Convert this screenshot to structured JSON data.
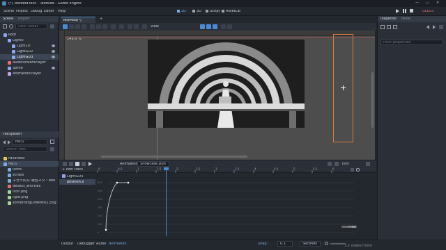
{
  "window": {
    "title": "(*) TestMod.tscn - TestMod - Godot Engine",
    "controls": [
      "—",
      "□",
      "✕"
    ]
  },
  "menu": [
    "Scene",
    "Project",
    "Debug",
    "Editor",
    "Help"
  ],
  "workspaces": [
    "2D",
    "3D",
    "Script",
    "AssetLib"
  ],
  "renderer": "GLES3",
  "scene_dock": {
    "tabs": [
      "Scene",
      "Import"
    ],
    "filter_placeholder": "Filter nodes",
    "nodes": [
      "Root",
      "Light0",
      "Light2D",
      "LightGD2",
      "LightGD3",
      "AudioStreamPlayer",
      "Sprite",
      "AnimationPlayer"
    ]
  },
  "filesystem_dock": {
    "title": "FileSystem",
    "path": "res://",
    "search_placeholder": "Search files",
    "favorites": "Favorites:",
    "files": [
      "res://",
      "icons",
      "scripts",
      "ネガテ的な 場合ネタ・WAT",
      "default_env.tres",
      "icon.png",
      "light.png",
      "somethingDifferent2.png"
    ]
  },
  "scene_tabs": [
    "TestMod(*)",
    "+"
  ],
  "viewport": {
    "zoom": "149.8 %",
    "toolbar_label": "View"
  },
  "animation": {
    "panel_label": "Animation",
    "animation_name": "Showcase.json",
    "add_track": "+ Add Track",
    "edit": "Edit",
    "tracks": [
      "LightGD3",
      "position:x"
    ],
    "ruler": [
      "0",
      "0.5",
      "1",
      "1.5",
      "2",
      "2.5",
      "3",
      "3.5",
      "4",
      "4.5",
      "5",
      "5.5",
      "6"
    ],
    "yvals": [
      "0",
      "100",
      "200",
      "300",
      "400",
      "500",
      "600"
    ],
    "snap_label": "Snap:",
    "snap_value": "0.1",
    "units": "Seconds",
    "free": "Free"
  },
  "inspector": {
    "tabs": [
      "Inspector",
      "Node"
    ],
    "filter_placeholder": "Filter properties"
  },
  "bottom_tabs": [
    "Output",
    "Debugger",
    "Audio",
    "Animation"
  ],
  "version": "3.x stable.mono"
}
